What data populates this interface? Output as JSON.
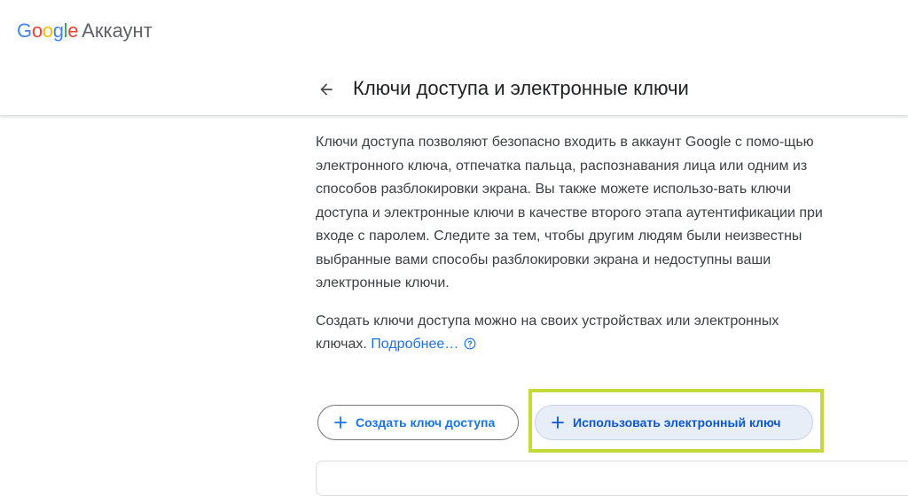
{
  "header": {
    "logo_letters": [
      "G",
      "o",
      "o",
      "g",
      "l",
      "e"
    ],
    "product": "Аккаунт"
  },
  "page": {
    "title": "Ключи доступа и электронные ключи",
    "back_icon": "arrow-back-icon"
  },
  "content": {
    "description": "Ключи доступа позволяют безопасно входить в аккаунт Google с помо-щью электронного ключа, отпечатка пальца, распознавания лица или одним из способов разблокировки экрана. Вы также можете использо-вать ключи доступа и электронные ключи в качестве второго этапа аутентификации при входе с паролем. Следите за тем, чтобы другим людям были неизвестны выбранные вами способы разблокировки экрана и недоступны ваши электронные ключи.",
    "create_text": "Создать ключи доступа можно на своих устройствах или электронных ключах.",
    "learn_more": "Подробнее…"
  },
  "buttons": {
    "create_passkey": "Создать ключ доступа",
    "use_security_key": "Использовать электронный ключ"
  },
  "colors": {
    "accent": "#1a73e8",
    "highlight": "#c5d93a",
    "tonal_bg": "#e8eef8"
  }
}
